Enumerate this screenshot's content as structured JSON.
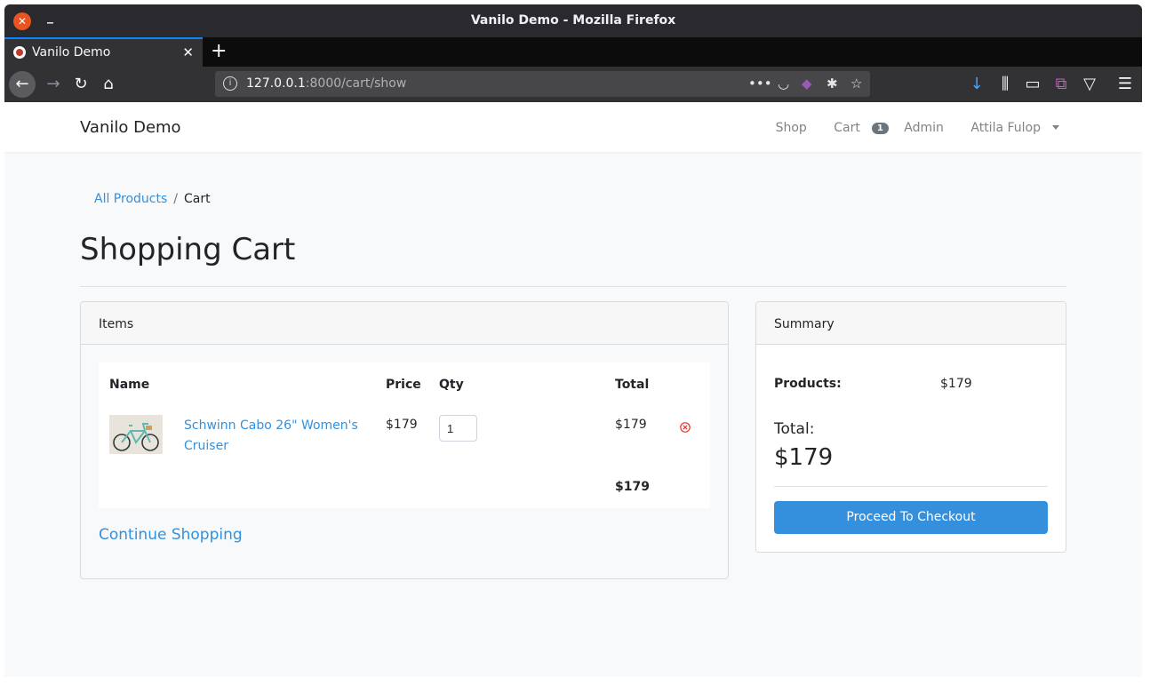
{
  "browser": {
    "window_title": "Vanilo Demo - Mozilla Firefox",
    "tab_label": "Vanilo Demo",
    "url_host": "127.0.0.1",
    "url_path": ":8000/cart/show"
  },
  "site": {
    "brand": "Vanilo Demo",
    "nav": {
      "shop": "Shop",
      "cart": "Cart",
      "cart_count": "1",
      "admin": "Admin",
      "user": "Attila Fulop"
    }
  },
  "breadcrumb": {
    "link": "All Products",
    "separator": "/",
    "current": "Cart"
  },
  "page_title": "Shopping Cart",
  "items": {
    "header": "Items",
    "columns": {
      "name": "Name",
      "price": "Price",
      "qty": "Qty",
      "total": "Total"
    },
    "rows": [
      {
        "name": "Schwinn Cabo 26\" Women's Cruiser",
        "price": "$179",
        "qty": "1",
        "total": "$179"
      }
    ],
    "grand_total": "$179",
    "continue_label": "Continue Shopping"
  },
  "summary": {
    "header": "Summary",
    "products_label": "Products:",
    "products_value": "$179",
    "total_label": "Total:",
    "total_value": "$179",
    "checkout_label": "Proceed To Checkout"
  },
  "colors": {
    "accent": "#3490dc",
    "remove": "#e3342f"
  }
}
